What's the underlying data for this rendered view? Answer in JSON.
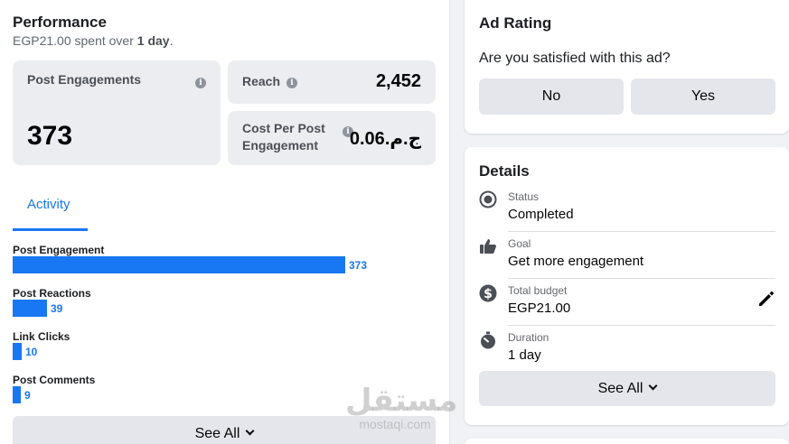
{
  "performance": {
    "title": "Performance",
    "spent_prefix": "EGP21.00",
    "spent_mid": " spent over ",
    "spent_bold": "1 day",
    "spent_suffix": "."
  },
  "stats": {
    "post_engagements": {
      "label": "Post Engagements",
      "value": "373"
    },
    "reach": {
      "label": "Reach",
      "value": "2,452"
    },
    "cost_per_engagement": {
      "label_line1": "Cost Per Post",
      "label_line2": "Engagement",
      "value": "ج.م.0.06"
    }
  },
  "activity_tab": {
    "label": "Activity"
  },
  "chart_data": {
    "type": "bar",
    "orientation": "horizontal",
    "categories": [
      "Post Engagement",
      "Post Reactions",
      "Link Clicks",
      "Post Comments"
    ],
    "values": [
      373,
      39,
      10,
      9
    ],
    "value_labels": [
      "373",
      "39",
      "10",
      "9"
    ],
    "color": "#1877f2"
  },
  "performance_see_all": {
    "label": "See All"
  },
  "ad_rating": {
    "title": "Ad Rating",
    "question": "Are you satisfied with this ad?",
    "no_label": "No",
    "yes_label": "Yes"
  },
  "details": {
    "title": "Details",
    "rows": [
      {
        "label": "Status",
        "value": "Completed",
        "icon": "status-radio-icon"
      },
      {
        "label": "Goal",
        "value": "Get more engagement",
        "icon": "thumbs-up-icon"
      },
      {
        "label": "Total budget",
        "value": "EGP21.00",
        "icon": "dollar-circle-icon"
      },
      {
        "label": "Duration",
        "value": "1 day",
        "icon": "stopwatch-icon"
      }
    ],
    "see_all_label": "See All"
  },
  "watermark": {
    "arabic": "مستقل",
    "latin": "mostaqi.com"
  },
  "colors": {
    "accent": "#1877f2",
    "card_bg": "#ffffff",
    "page_bg": "#f0f2f5",
    "stat_box_bg": "#ebedf0",
    "button_bg": "#e4e6eb"
  }
}
